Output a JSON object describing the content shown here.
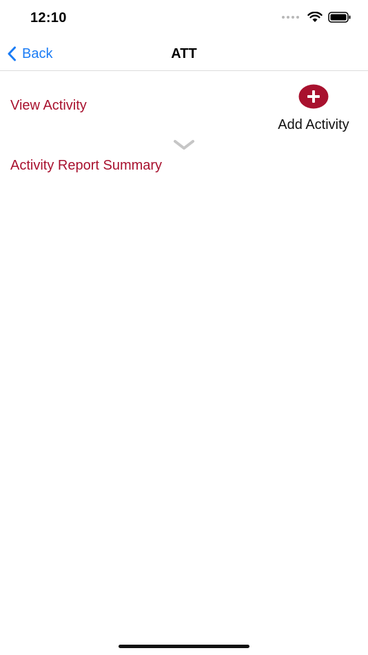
{
  "status_bar": {
    "time": "12:10"
  },
  "nav": {
    "back_label": "Back",
    "title": "ATT"
  },
  "content": {
    "view_activity": "View Activity",
    "add_activity": "Add Activity",
    "report_summary": "Activity Report Summary"
  },
  "colors": {
    "accent": "#a8112e",
    "link_blue": "#1a7cf5"
  },
  "icons": {
    "back": "chevron-left-icon",
    "add": "plus-circle-icon",
    "expand": "chevron-down-icon",
    "wifi": "wifi-icon",
    "battery": "battery-icon"
  }
}
